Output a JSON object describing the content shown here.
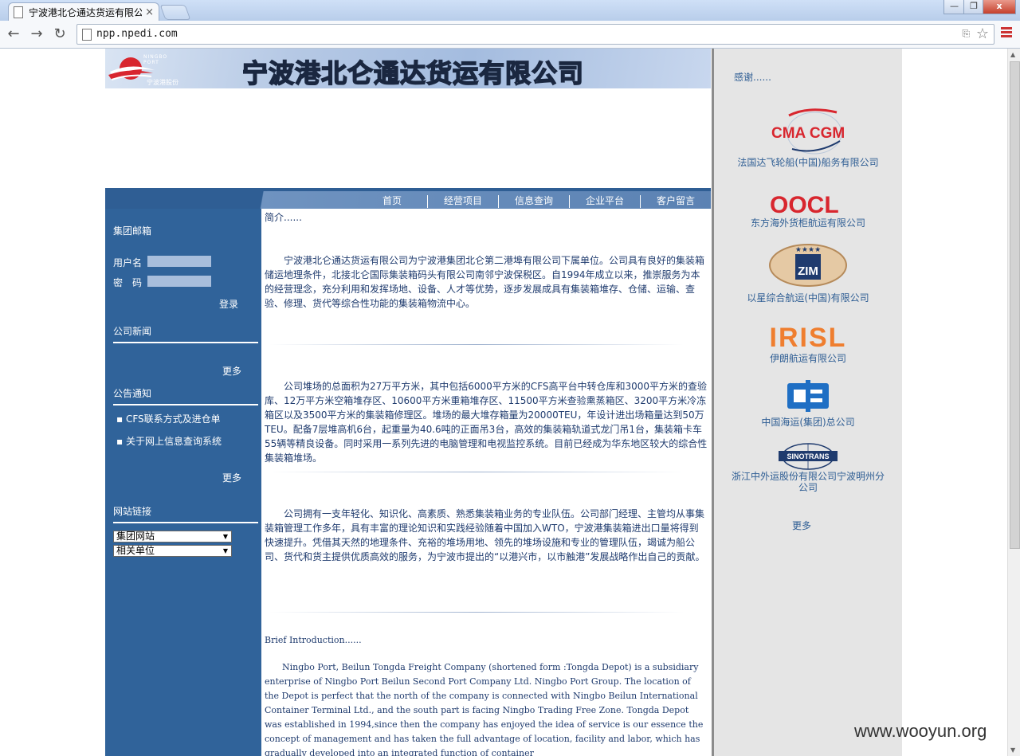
{
  "browser": {
    "tab_title": "宁波港北仑通达货运有限公司",
    "tab_close": "×",
    "url": "npp.npedi.com",
    "window_minimize": "—",
    "window_restore": "❐",
    "window_close": "x"
  },
  "site": {
    "logo_text_top": "NINGBO PORT",
    "logo_text_bottom": "宁波港股份",
    "title": "宁波港北仑通达货运有限公司"
  },
  "nav": [
    "首页",
    "经营项目",
    "信息查询",
    "企业平台",
    "客户留言"
  ],
  "sidebar": {
    "mail_title": "集团邮箱",
    "username_label": "用户名",
    "password_label": "密　码",
    "login_label": "登录",
    "news_title": "公司新闻",
    "news_more": "更多",
    "notice_title": "公告通知",
    "notices": [
      "CFS联系方式及进仓单",
      "关于网上信息查询系统"
    ],
    "notice_more": "更多",
    "links_title": "网站链接",
    "link_select_1": "集团网站",
    "link_select_2": "相关单位"
  },
  "main": {
    "intro_heading": "简介......",
    "para1": "宁波港北仑通达货运有限公司为宁波港集团北仑第二港埠有限公司下属单位。公司具有良好的集装箱储运地理条件，北接北仑国际集装箱码头有限公司南邻宁波保税区。自1994年成立以来，推崇服务为本的经营理念，充分利用和发挥场地、设备、人才等优势，逐步发展成具有集装箱堆存、仓储、运输、查验、修理、货代等综合性功能的集装箱物流中心。",
    "para2": "公司堆场的总面积为27万平方米，其中包括6000平方米的CFS高平台中转仓库和3000平方米的查验库、12万平方米空箱堆存区、10600平方米重箱堆存区、11500平方米查验熏蒸箱区、3200平方米冷冻箱区以及3500平方米的集装箱修理区。堆场的最大堆存箱量为20000TEU，年设计进出场箱量达到50万TEU。配备7层堆高机6台，起重量为40.6吨的正面吊3台，高效的集装箱轨道式龙门吊1台，集装箱卡车55辆等精良设备。同时采用一系列先进的电脑管理和电视监控系统。目前已经成为华东地区较大的综合性集装箱堆场。",
    "para3": "公司拥有一支年轻化、知识化、高素质、熟悉集装箱业务的专业队伍。公司部门经理、主管均从事集装箱管理工作多年，具有丰富的理论知识和实践经验随着中国加入WTO，宁波港集装箱进出口量将得到快速提升。凭借其天然的地理条件、充裕的堆场用地、领先的堆场设施和专业的管理队伍，竭诚为船公司、货代和货主提供优质高效的服务，为宁波市提出的“以港兴市，以市触港”发展战略作出自己的贡献。",
    "en_heading": "Brief Introduction......",
    "en_para": "Ningbo Port, Beilun Tongda Freight Company (shortened form :Tongda Depot) is a subsidiary enterprise of Ningbo Port Beilun Second Port Company Ltd. Ningbo Port Group. The location of the Depot is perfect that the north of the company is connected with Ningbo Beilun International Container Terminal Ltd., and the south part is facing Ningbo Trading Free Zone. Tongda Depot was established in 1994,since then the company has enjoyed the idea of service is our essence the concept of management and has taken the full advantage of location, facility and labor, which has gradually developed into an integrated function of container"
  },
  "right": {
    "thanks": "感谢......",
    "partners": [
      {
        "logo": "CMA CGM",
        "name": "法国达飞轮船(中国)船务有限公司"
      },
      {
        "logo": "OOCL",
        "name": "东方海外货柜航运有限公司"
      },
      {
        "logo": "ZIM",
        "name": "以星综合航运(中国)有限公司"
      },
      {
        "logo": "IRISL",
        "name": "伊朗航运有限公司"
      },
      {
        "logo": "",
        "name": "中国海运(集团)总公司"
      },
      {
        "logo": "SINOTRANS",
        "name": "浙江中外运股份有限公司宁波明州分公司"
      }
    ],
    "more": "更多"
  },
  "watermark": "www.wooyun.org",
  "colors": {
    "nav_blue": "#2f5e94",
    "sidebar_blue": "#30639a",
    "text_blue": "#1f3b6e"
  }
}
